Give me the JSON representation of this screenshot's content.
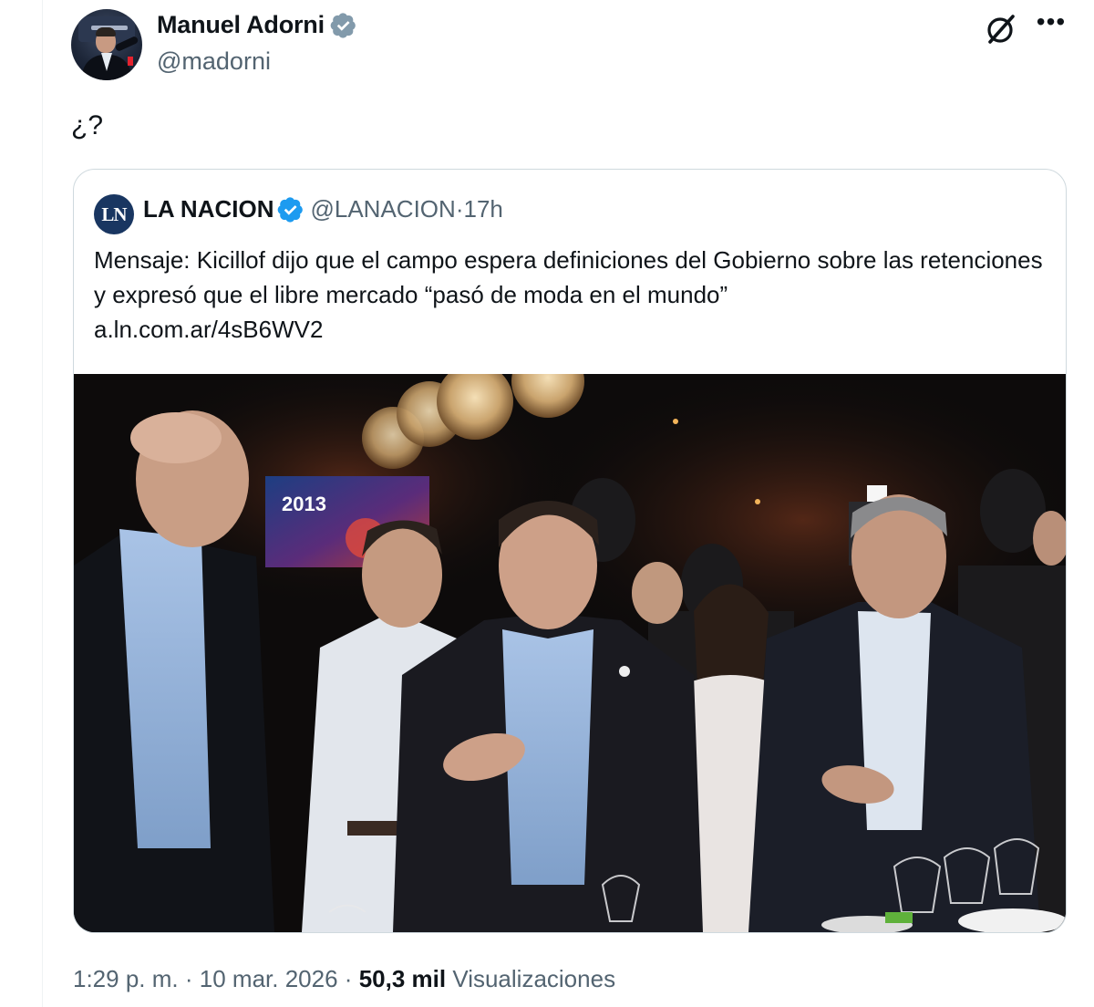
{
  "author": {
    "name": "Manuel Adorni",
    "handle": "@madorni",
    "verified_color": "#829aab"
  },
  "icons": {
    "grok": "grok-icon",
    "more": "more-options-icon",
    "verified": "verified-badge-icon"
  },
  "tweet": {
    "text": "¿?"
  },
  "quoted": {
    "avatar_text": "LN",
    "name": "LA NACION",
    "handle": "@LANACION",
    "separator": "·",
    "time": "17h",
    "text": "Mensaje: Kicillof dijo que el campo espera definiciones del Gobierno sobre las retenciones y expresó que el libre mercado “pasó de moda en el mundo”",
    "link": "a.ln.com.ar/4sB6WV2",
    "verified_color": "#1d9bf0"
  },
  "photo_screen_text": "2013",
  "footer": {
    "time": "1:29 p. m.",
    "sep1": "·",
    "date": "10 mar. 2026",
    "sep2": "·",
    "views_count": "50,3 mil",
    "views_label": "Visualizaciones"
  }
}
